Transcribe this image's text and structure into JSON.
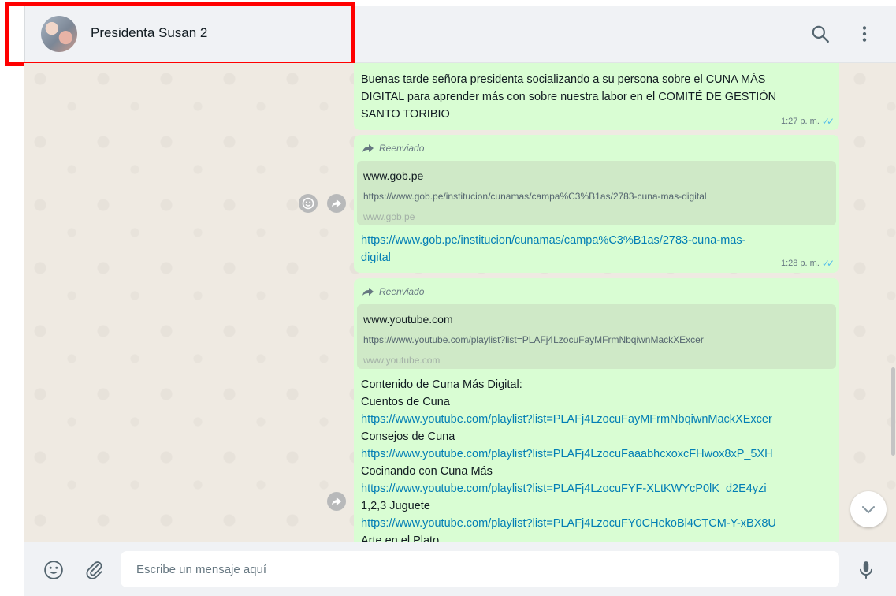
{
  "header": {
    "contact_name": "Presidenta Susan 2",
    "avatar": "avatar-photo",
    "icons": [
      "search-icon",
      "menu-icon"
    ]
  },
  "messages": {
    "m1": {
      "lines": [
        "Buenas tarde señora presidenta socializando a su persona sobre el CUNA MÁS",
        "DIGITAL para aprender más con sobre nuestra labor en el COMITÉ DE GESTIÓN",
        "SANTO TORIBIO"
      ],
      "time": "1:27 p. m."
    },
    "m2": {
      "forwarded": "Reenviado",
      "preview_site": "www.gob.pe",
      "preview_url": "https://www.gob.pe/institucion/cunamas/campa%C3%B1as/2783-cuna-mas-digital",
      "preview_host": "www.gob.pe",
      "link_line1": "https://www.gob.pe/institucion/cunamas/campa%C3%B1as/2783-cuna-mas-",
      "link_line2": "digital",
      "time": "1:28 p. m."
    },
    "m3": {
      "forwarded": "Reenviado",
      "preview_site": "www.youtube.com",
      "preview_url": "https://www.youtube.com/playlist?list=PLAFj4LzocuFayMFrmNbqiwnMackXExcer",
      "preview_host": "www.youtube.com",
      "lines": [
        {
          "text": "Contenido de Cuna Más Digital:",
          "link": false
        },
        {
          "text": "Cuentos de Cuna",
          "link": false
        },
        {
          "text": "https://www.youtube.com/playlist?list=PLAFj4LzocuFayMFrmNbqiwnMackXExcer",
          "link": true
        },
        {
          "text": "Consejos de Cuna",
          "link": false
        },
        {
          "text": "https://www.youtube.com/playlist?list=PLAFj4LzocuFaaabhcxoxcFHwox8xP_5XH",
          "link": true
        },
        {
          "text": "Cocinando con Cuna Más",
          "link": false
        },
        {
          "text": "https://www.youtube.com/playlist?list=PLAFj4LzocuFYF-XLtKWYcP0lK_d2E4yzi",
          "link": true
        },
        {
          "text": "1,2,3 Juguete",
          "link": false
        },
        {
          "text": "https://www.youtube.com/playlist?list=PLAFj4LzocuFY0CHekoBl4CTCM-Y-xBX8U",
          "link": true
        },
        {
          "text": "Arte en el Plato",
          "link": false
        }
      ]
    }
  },
  "footer": {
    "input_placeholder": "Escribe un mensaje aquí",
    "icons": [
      "emoji-icon",
      "attach-icon",
      "mic-icon"
    ]
  },
  "colors": {
    "outgoing_bubble": "#d9fdd3",
    "link": "#027eb5",
    "highlight": "#ff0000",
    "read_ticks": "#53bdeb"
  }
}
